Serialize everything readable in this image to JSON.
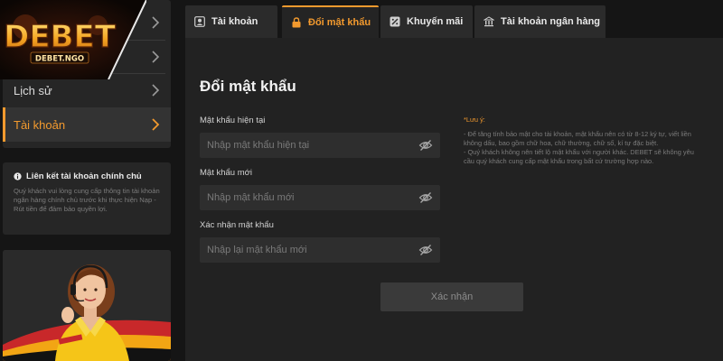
{
  "brand": {
    "name": "DEBET",
    "domain": "DEBET.NGO",
    "accent": "#f39a2e"
  },
  "sidebar": {
    "items": [
      {
        "label": "",
        "icon": "chevron-right-icon"
      },
      {
        "label": "",
        "icon": "chevron-right-icon"
      },
      {
        "label": "Lịch sử",
        "icon": "chevron-right-icon"
      },
      {
        "label": "Tài khoản",
        "icon": "chevron-right-icon",
        "active": true
      }
    ]
  },
  "info_card": {
    "title": "Liên kết tài khoản chính chủ",
    "text": "Quý khách vui lòng cung cấp thông tin tài khoản ngân hàng chính chủ trước khi thực hiện Nạp - Rút tiền để đảm bảo quyền lợi."
  },
  "tabs": [
    {
      "label": "Tài khoản",
      "icon": "user-card-icon"
    },
    {
      "label": "Đổi mật khẩu",
      "icon": "lock-icon",
      "active": true
    },
    {
      "label": "Khuyến mãi",
      "icon": "promo-icon"
    },
    {
      "label": "Tài khoản ngân hàng",
      "icon": "bank-icon"
    }
  ],
  "form": {
    "title": "Đổi mật khẩu",
    "current": {
      "label": "Mật khẩu hiện tại",
      "placeholder": "Nhập mật khẩu hiện tại",
      "value": ""
    },
    "new": {
      "label": "Mật khẩu mới",
      "placeholder": "Nhập mật khẩu mới",
      "value": ""
    },
    "confirm": {
      "label": "Xác nhận mật khẩu",
      "placeholder": "Nhập lại mật khẩu mới",
      "value": ""
    },
    "submit_label": "Xác nhận"
  },
  "note": {
    "title": "*Lưu ý:",
    "line1": "- Để tăng tính bảo mật cho tài khoản, mật khẩu nên có từ 8-12 ký tự, viết liền không dấu, bao gồm chữ hoa, chữ thường, chữ số, kí tự đặc biệt.",
    "line2": "- Quý khách không nên tiết lộ mật khẩu với người khác. DEBET sẽ không yêu cầu quý khách cung cấp mật khẩu trong bất cứ trường hợp nào."
  }
}
